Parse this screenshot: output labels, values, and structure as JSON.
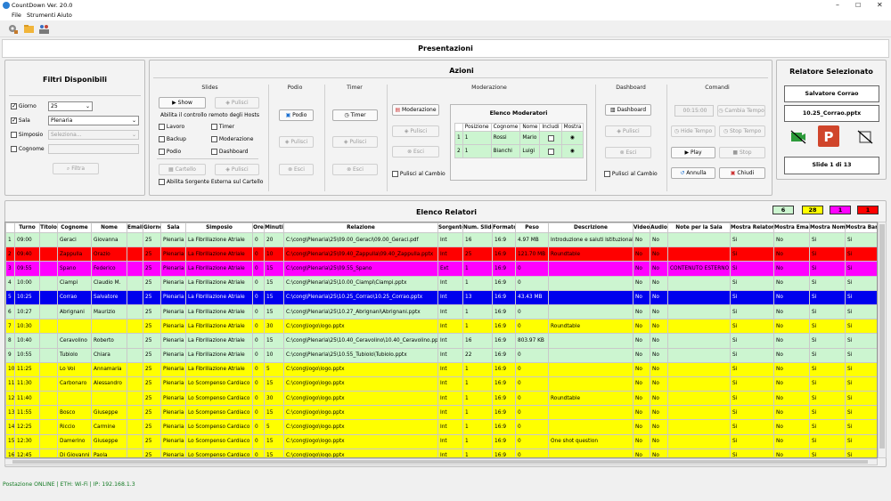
{
  "window": {
    "title": "CountDown Ver. 20.0"
  },
  "menu": [
    "File",
    "Strumenti",
    "Aiuto"
  ],
  "presentazioni": "Presentazioni",
  "filtri": {
    "title": "Filtri Disponibili",
    "giorno_label": "Giorno",
    "giorno_value": "25",
    "sala_label": "Sala",
    "sala_value": "Plenaria",
    "simposio_label": "Simposio",
    "simposio_value": "Seleziona...",
    "cognome_label": "Cognome",
    "cognome_value": "",
    "filtra": "Filtra"
  },
  "azioni": {
    "title": "Azioni",
    "slides": {
      "label": "Slides",
      "show": "Show",
      "pulisci": "Pulisci",
      "abilita": "Abilita il controllo remoto degli Hosts",
      "lavoro": "Lavoro",
      "timer": "Timer",
      "backup": "Backup",
      "moderazione": "Moderazione",
      "podio": "Podio",
      "dashboard": "Dashboard",
      "cartello": "Cartello",
      "pulisci2": "Pulisci",
      "abilita_sorgente": "Abilita Sorgente Esterna sul Cartello"
    },
    "podio": {
      "label": "Podio",
      "podio": "Podio",
      "pulisci": "Pulisci",
      "esci": "Esci"
    },
    "timer": {
      "label": "Timer",
      "timer": "Timer",
      "pulisci": "Pulisci",
      "esci": "Esci"
    },
    "moderazione": {
      "label": "Moderazione",
      "moderazione": "Moderazione",
      "pulisci": "Pulisci",
      "esci": "Esci",
      "pulisci_cambio": "Pulisci al Cambio",
      "elenco": "Elenco Moderatori",
      "cols": [
        "Posizione",
        "Cognome",
        "Nome",
        "Includi",
        "Mostra"
      ],
      "rows": [
        [
          "1",
          "1",
          "Rossi",
          "Mario"
        ],
        [
          "2",
          "1",
          "Bianchi",
          "Luigi"
        ]
      ]
    },
    "dashboard": {
      "label": "Dashboard",
      "dashboard": "Dashboard",
      "pulisci": "Pulisci",
      "esci": "Esci",
      "pulisci_cambio": "Pulisci al Cambio"
    },
    "comandi": {
      "label": "Comandi",
      "time": "00:15:00",
      "cambia": "Cambia Tempo",
      "hide": "Hide Tempo",
      "stop_tempo": "Stop Tempo",
      "play": "Play",
      "stop": "Stop",
      "annulla": "Annulla",
      "chiudi": "Chiudi"
    }
  },
  "relatore": {
    "title": "Relatore Selezionato",
    "name": "Salvatore Corrao",
    "file": "10.25_Corrao.pptx",
    "slide": "Slide 1 di 13"
  },
  "badges": [
    {
      "value": "6",
      "color": "#ccf5d0"
    },
    {
      "value": "28",
      "color": "#ffff00"
    },
    {
      "value": "1",
      "color": "#ff00ff"
    },
    {
      "value": "1",
      "color": "#ff0000"
    }
  ],
  "elenco": {
    "title": "Elenco Relatori",
    "columns": [
      "",
      "Turno",
      "Titolo",
      "Cognome",
      "Nome",
      "Email",
      "Giorno",
      "Sala",
      "Simposio",
      "Ore",
      "Minuti",
      "Relazione",
      "Sorgente",
      "Num. Slide",
      "Formato",
      "Peso",
      "Descrizione",
      "Video",
      "Audio",
      "Note per la Sala",
      "Mostra Relatore",
      "Mostra Email",
      "Mostra Nome",
      "Mostra Barra",
      "Mostr"
    ],
    "rows": [
      {
        "bg": "#ccf5d0",
        "c": [
          "1",
          "09:00",
          "",
          "Geraci",
          "Giovanna",
          "",
          "25",
          "Plenaria",
          "La Fibrillazione Atriale",
          "0",
          "20",
          "C:\\cong\\Plenaria\\25\\09.00_Geraci\\09.00_Geraci.pdf",
          "Int",
          "16",
          "16:9",
          "4.97 MB",
          "Introduzione e saluti Istituzionali",
          "No",
          "No",
          "",
          "Si",
          "No",
          "Si",
          "Si",
          "Si"
        ]
      },
      {
        "bg": "#ff0000",
        "c": [
          "2",
          "09:40",
          "",
          "Zappulla",
          "Orazio",
          "",
          "25",
          "Plenaria",
          "La Fibrillazione Atriale",
          "0",
          "10",
          "C:\\cong\\Plenaria\\25\\09.40_Zappulla\\09.40_Zappulla.pptx",
          "Int",
          "25",
          "16:9",
          "121.70 MB",
          "Roundtable",
          "No",
          "No",
          "",
          "Si",
          "No",
          "Si",
          "Si",
          "Si"
        ]
      },
      {
        "bg": "#ff00ff",
        "c": [
          "3",
          "09:55",
          "",
          "Spano",
          "Federico",
          "",
          "25",
          "Plenaria",
          "La Fibrillazione Atriale",
          "0",
          "15",
          "C:\\cong\\Plenaria\\25\\09.55_Spano",
          "Ext",
          "1",
          "16:9",
          "0",
          "",
          "No",
          "No",
          "CONTENUTO ESTERNO",
          "Si",
          "No",
          "Si",
          "Si",
          "Si"
        ]
      },
      {
        "bg": "#ccf5d0",
        "c": [
          "4",
          "10:00",
          "",
          "Ciampi",
          "Claudio M.",
          "",
          "25",
          "Plenaria",
          "La Fibrillazione Atriale",
          "0",
          "15",
          "C:\\cong\\Plenaria\\25\\10.00_Ciampi\\Ciampi.pptx",
          "Int",
          "1",
          "16:9",
          "0",
          "",
          "No",
          "No",
          "",
          "Si",
          "No",
          "Si",
          "Si",
          "Si"
        ]
      },
      {
        "bg": "#0000ee",
        "fg": "#fff",
        "c": [
          "5",
          "10:25",
          "",
          "Corrao",
          "Salvatore",
          "",
          "25",
          "Plenaria",
          "La Fibrillazione Atriale",
          "0",
          "15",
          "C:\\cong\\Plenaria\\25\\10.25_Corrao\\10.25_Corrao.pptx",
          "Int",
          "13",
          "16:9",
          "43.43 MB",
          "",
          "No",
          "No",
          "",
          "Si",
          "No",
          "Si",
          "Si",
          "Si"
        ]
      },
      {
        "bg": "#ccf5d0",
        "c": [
          "6",
          "10:27",
          "",
          "Abrignani",
          "Maurizio",
          "",
          "25",
          "Plenaria",
          "La Fibrillazione Atriale",
          "0",
          "15",
          "C:\\cong\\Plenaria\\25\\10.27_Abrignani\\Abrignani.pptx",
          "Int",
          "1",
          "16:9",
          "0",
          "",
          "No",
          "No",
          "",
          "Si",
          "No",
          "Si",
          "Si",
          "Si"
        ]
      },
      {
        "bg": "#ffff00",
        "c": [
          "7",
          "10:30",
          "",
          "",
          "",
          "",
          "25",
          "Plenaria",
          "La Fibrillazione Atriale",
          "0",
          "30",
          "C:\\cong\\logo\\logo.pptx",
          "Int",
          "1",
          "16:9",
          "0",
          "Roundtable",
          "No",
          "No",
          "",
          "Si",
          "No",
          "Si",
          "Si",
          "Si"
        ]
      },
      {
        "bg": "#ccf5d0",
        "c": [
          "8",
          "10:40",
          "",
          "Ceravolino",
          "Roberto",
          "",
          "25",
          "Plenaria",
          "La Fibrillazione Atriale",
          "0",
          "15",
          "C:\\cong\\Plenaria\\25\\10.40_Ceravolino\\10.40_Ceravolino.pptx",
          "Int",
          "16",
          "16:9",
          "803.97 KB",
          "",
          "No",
          "No",
          "",
          "Si",
          "No",
          "Si",
          "Si",
          "Si"
        ]
      },
      {
        "bg": "#ccf5d0",
        "c": [
          "9",
          "10:55",
          "",
          "Tubiolo",
          "Chiara",
          "",
          "25",
          "Plenaria",
          "La Fibrillazione Atriale",
          "0",
          "10",
          "C:\\cong\\Plenaria\\25\\10.55_Tubiolo\\Tubiolo.pptx",
          "Int",
          "22",
          "16:9",
          "0",
          "",
          "No",
          "No",
          "",
          "Si",
          "No",
          "Si",
          "Si",
          "Si"
        ]
      },
      {
        "bg": "#ffff00",
        "c": [
          "10",
          "11:25",
          "",
          "Lo Voi",
          "Annamaria",
          "",
          "25",
          "Plenaria",
          "La Fibrillazione Atriale",
          "0",
          "5",
          "C:\\cong\\logo\\logo.pptx",
          "Int",
          "1",
          "16:9",
          "0",
          "",
          "No",
          "No",
          "",
          "Si",
          "No",
          "Si",
          "Si",
          "Si"
        ]
      },
      {
        "bg": "#ffff00",
        "c": [
          "11",
          "11:30",
          "",
          "Carbonaro",
          "Alessandro",
          "",
          "25",
          "Plenaria",
          "Lo Scompenso Cardiaco",
          "0",
          "15",
          "C:\\cong\\logo\\logo.pptx",
          "Int",
          "1",
          "16:9",
          "0",
          "",
          "No",
          "No",
          "",
          "Si",
          "No",
          "Si",
          "Si",
          "Si"
        ]
      },
      {
        "bg": "#ffff00",
        "c": [
          "12",
          "11:40",
          "",
          "",
          "",
          "",
          "25",
          "Plenaria",
          "Lo Scompenso Cardiaco",
          "0",
          "30",
          "C:\\cong\\logo\\logo.pptx",
          "Int",
          "1",
          "16:9",
          "0",
          "Roundtable",
          "No",
          "No",
          "",
          "Si",
          "No",
          "Si",
          "Si",
          "Si"
        ]
      },
      {
        "bg": "#ffff00",
        "c": [
          "13",
          "11:55",
          "",
          "Bosco",
          "Giuseppe",
          "",
          "25",
          "Plenaria",
          "Lo Scompenso Cardiaco",
          "0",
          "15",
          "C:\\cong\\logo\\logo.pptx",
          "Int",
          "1",
          "16:9",
          "0",
          "",
          "No",
          "No",
          "",
          "Si",
          "No",
          "Si",
          "Si",
          "Si"
        ]
      },
      {
        "bg": "#ffff00",
        "c": [
          "14",
          "12:25",
          "",
          "Riccio",
          "Carmine",
          "",
          "25",
          "Plenaria",
          "Lo Scompenso Cardiaco",
          "0",
          "5",
          "C:\\cong\\logo\\logo.pptx",
          "Int",
          "1",
          "16:9",
          "0",
          "",
          "No",
          "No",
          "",
          "Si",
          "No",
          "Si",
          "Si",
          "Si"
        ]
      },
      {
        "bg": "#ffff00",
        "c": [
          "15",
          "12:30",
          "",
          "Damerino",
          "Giuseppe",
          "",
          "25",
          "Plenaria",
          "Lo Scompenso Cardiaco",
          "0",
          "15",
          "C:\\cong\\logo\\logo.pptx",
          "Int",
          "1",
          "16:9",
          "0",
          "One shot question",
          "No",
          "No",
          "",
          "Si",
          "No",
          "Si",
          "Si",
          "Si"
        ]
      },
      {
        "bg": "#ffff00",
        "c": [
          "16",
          "12:45",
          "",
          "Di Giovanni",
          "Paola",
          "",
          "25",
          "Plenaria",
          "Lo Scompenso Cardiaco",
          "0",
          "15",
          "C:\\cong\\logo\\logo.pptx",
          "Int",
          "1",
          "16:9",
          "0",
          "",
          "No",
          "No",
          "",
          "Si",
          "No",
          "Si",
          "Si",
          "Si"
        ]
      }
    ]
  },
  "status": "Postazione ONLINE | ETH: Wi-Fi | IP: 192.168.1.3"
}
